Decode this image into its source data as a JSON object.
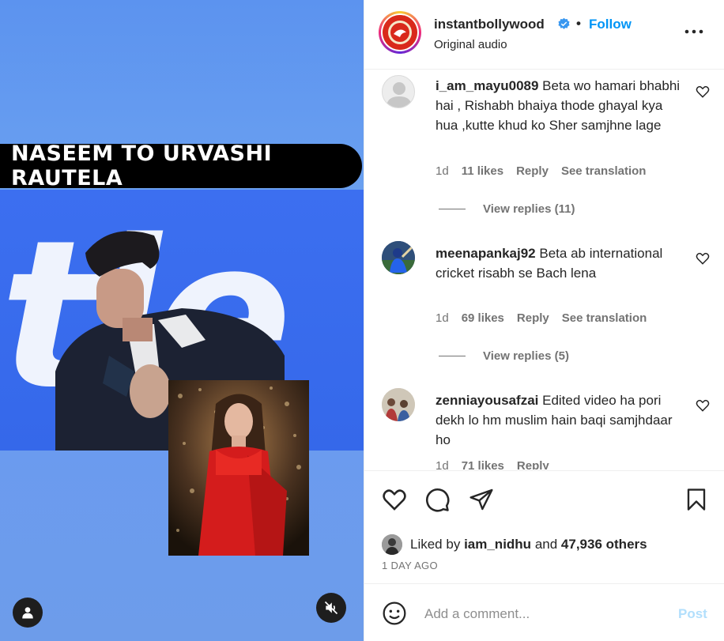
{
  "media": {
    "caption": "NASEEM TO URVASHI RAUTELA",
    "background_text": "tle",
    "user_tag_icon": "person-icon",
    "mute_icon": "speaker-muted-icon"
  },
  "header": {
    "username": "instantbollywood",
    "verified_icon": "verified-badge-icon",
    "separator": "•",
    "follow_label": "Follow",
    "audio": "Original audio",
    "more_icon": "more-options-icon"
  },
  "comments": [
    {
      "username": "i_am_mayu0089",
      "text": "Beta wo hamari bhabhi hai , Rishabh bhaiya thode ghayal kya hua ,kutte khud ko Sher samjhne lage",
      "age": "1d",
      "likes": "11 likes",
      "reply": "Reply",
      "translate": "See translation",
      "replies": "View replies (11)"
    },
    {
      "username": "meenapankaj92",
      "text": "Beta ab international cricket risabh se Bach lena",
      "age": "1d",
      "likes": "69 likes",
      "reply": "Reply",
      "translate": "See translation",
      "replies": "View replies (5)"
    },
    {
      "username": "zenniayousafzai",
      "text": "Edited video ha pori dekh lo hm muslim hain baqi samjhdaar ho",
      "age": "1d",
      "likes": "71 likes",
      "reply": "Reply"
    }
  ],
  "actions": {
    "like_icon": "heart-icon",
    "comment_icon": "comment-icon",
    "share_icon": "send-icon",
    "save_icon": "bookmark-icon",
    "liked_by_prefix": "Liked by",
    "liked_by_user": "iam_nidhu",
    "liked_by_and": "and",
    "liked_by_others": "47,936 others",
    "date": "1 DAY AGO"
  },
  "composer": {
    "emoji_icon": "emoji-icon",
    "placeholder": "Add a comment...",
    "post_label": "Post"
  },
  "colors": {
    "accent": "#0095f6",
    "post_disabled": "#b2dffc",
    "muted_text": "#737373"
  }
}
